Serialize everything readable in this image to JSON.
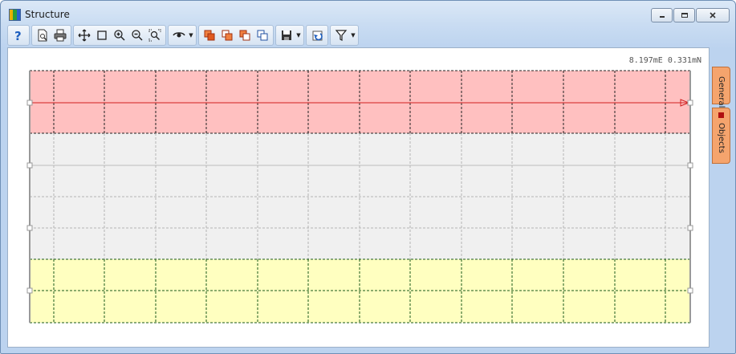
{
  "window": {
    "title": "Structure",
    "minimize_icon": "minimize-icon",
    "restore_icon": "restore-icon",
    "close_icon": "close-icon"
  },
  "toolbar": {
    "buttons": [
      {
        "name": "help-button",
        "icon": "question-mark-icon"
      },
      {
        "name": "print-preview-button",
        "icon": "print-preview-icon"
      },
      {
        "name": "print-button",
        "icon": "printer-icon"
      },
      {
        "name": "pan-button",
        "icon": "move-icon"
      },
      {
        "name": "zoom-window-button",
        "icon": "rectangle-icon"
      },
      {
        "name": "zoom-in-button",
        "icon": "zoom-in-icon"
      },
      {
        "name": "zoom-out-button",
        "icon": "zoom-out-icon"
      },
      {
        "name": "zoom-extents-button",
        "icon": "zoom-extents-icon"
      },
      {
        "name": "view-button",
        "icon": "eye-icon"
      },
      {
        "name": "copy-style-1-button",
        "icon": "copy-icon"
      },
      {
        "name": "copy-style-2-button",
        "icon": "copy-icon"
      },
      {
        "name": "copy-style-3-button",
        "icon": "copy-icon"
      },
      {
        "name": "copy-style-4-button",
        "icon": "copy-icon"
      },
      {
        "name": "save-button",
        "icon": "floppy-icon"
      },
      {
        "name": "refresh-button",
        "icon": "undo-icon"
      },
      {
        "name": "filter-button",
        "icon": "filter-icon"
      }
    ]
  },
  "status": {
    "coordinates": "8.197mE 0.331mN"
  },
  "side_tabs": [
    {
      "label": "General",
      "color": "#0a7a1a"
    },
    {
      "label": "Objects",
      "color": "#b01010"
    }
  ],
  "colors": {
    "top_layer": "#ffc0c0",
    "middle_layer": "#f0f0f0",
    "bottom_layer": "#ffffc0",
    "profile_line": "#d02020",
    "accent_tab": "#f5a46d"
  }
}
